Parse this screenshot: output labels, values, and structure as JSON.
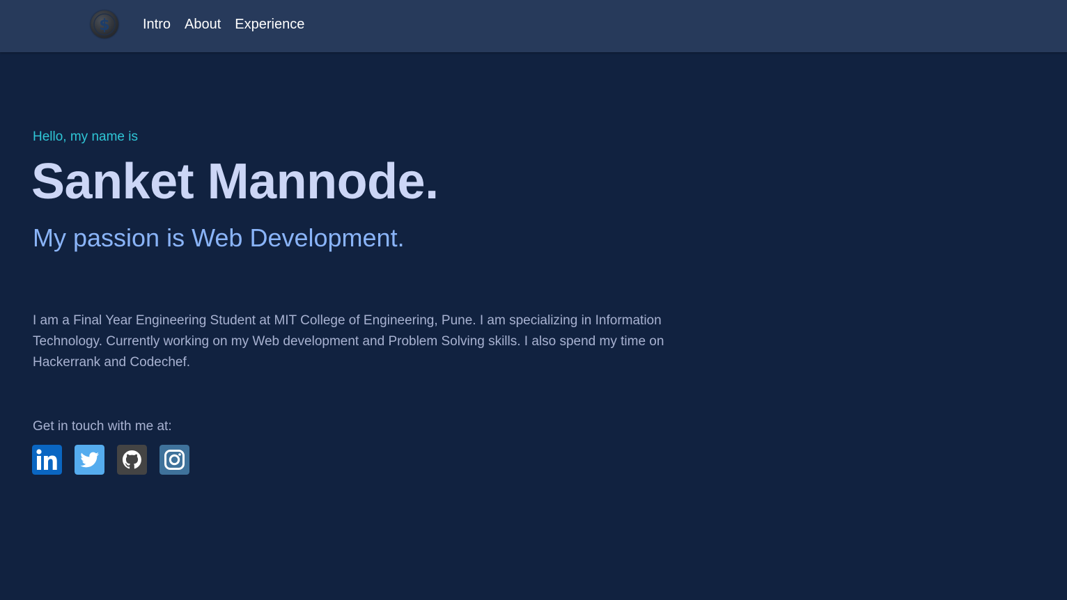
{
  "nav": {
    "logo_icon": "dollar-coin-icon",
    "links": [
      {
        "label": "Intro"
      },
      {
        "label": "About"
      },
      {
        "label": "Experience"
      }
    ]
  },
  "hero": {
    "greeting": "Hello, my name is",
    "name": "Sanket Mannode.",
    "passion": "My passion is Web Development.",
    "bio": "I am a Final Year Engineering Student at MIT College of Engineering, Pune. I am specializing in Information Technology. Currently working on my Web development and Problem Solving skills. I also spend my time on Hackerrank and Codechef."
  },
  "contact": {
    "label": "Get in touch with me at:",
    "socials": [
      {
        "icon": "linkedin-icon",
        "color": "#0a66c2"
      },
      {
        "icon": "twitter-icon",
        "color": "#55acee"
      },
      {
        "icon": "github-icon",
        "color": "#444444"
      },
      {
        "icon": "instagram-icon",
        "color": "#3f729b"
      }
    ]
  },
  "colors": {
    "background": "#112240",
    "navbar": "#273a5b",
    "accent_cyan": "#2fc6d6",
    "heading": "#ccd6f6",
    "subheading": "#8ab4f8",
    "body_text": "#a8b2d1"
  }
}
